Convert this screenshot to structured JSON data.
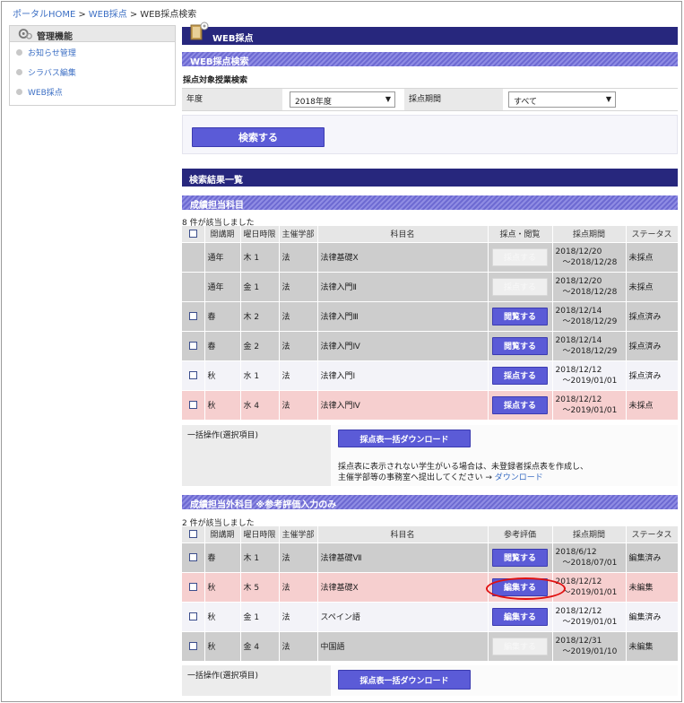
{
  "breadcrumb": {
    "home": "ポータルHOME",
    "sep": ">",
    "item1": "WEB採点",
    "current": "WEB採点検索"
  },
  "sidebar": {
    "title": "管理機能",
    "items": [
      {
        "label": "お知らせ管理"
      },
      {
        "label": "シラバス編集"
      },
      {
        "label": "WEB採点"
      }
    ]
  },
  "page": {
    "title": "WEB採点"
  },
  "search": {
    "section_title": "WEB採点検索",
    "subtitle": "採点対象授業検索",
    "year_label": "年度",
    "year_value": "2018年度",
    "period_label": "採点期間",
    "period_value": "すべて",
    "button": "検索する"
  },
  "results": {
    "title": "検索結果一覧"
  },
  "headers": {
    "open": "開講期",
    "day": "曜日時限",
    "faculty": "主催学部",
    "subject": "科目名",
    "grade_view": "採点・閲覧",
    "ref_eval": "参考評価",
    "period": "採点期間",
    "status": "ステータス"
  },
  "section1": {
    "title": "成績担当科目",
    "count": "8 件が該当しました",
    "rows": [
      {
        "open": "通年",
        "day": "木 1",
        "fac": "法",
        "subject": "法律基礎X",
        "btn": "採点する",
        "p1": "2018/12/20",
        "p2": "～2018/12/28",
        "status": "未採点"
      },
      {
        "open": "通年",
        "day": "金 1",
        "fac": "法",
        "subject": "法律入門Ⅱ",
        "btn": "採点する",
        "p1": "2018/12/20",
        "p2": "～2018/12/28",
        "status": "未採点"
      },
      {
        "open": "春",
        "day": "木 2",
        "fac": "法",
        "subject": "法律入門Ⅲ",
        "btn": "閲覧する",
        "p1": "2018/12/14",
        "p2": "～2018/12/29",
        "status": "採点済み"
      },
      {
        "open": "春",
        "day": "金 2",
        "fac": "法",
        "subject": "法律入門Ⅳ",
        "btn": "閲覧する",
        "p1": "2018/12/14",
        "p2": "～2018/12/29",
        "status": "採点済み"
      },
      {
        "open": "秋",
        "day": "水 1",
        "fac": "法",
        "subject": "法律入門Ⅰ",
        "btn": "採点する",
        "p1": "2018/12/12",
        "p2": "～2019/01/01",
        "status": "採点済み"
      },
      {
        "open": "秋",
        "day": "水 4",
        "fac": "法",
        "subject": "法律入門Ⅳ",
        "btn": "採点する",
        "p1": "2018/12/12",
        "p2": "～2019/01/01",
        "status": "未採点"
      }
    ],
    "bulk_label": "一括操作(選択項目)",
    "download_button": "採点表一括ダウンロード",
    "note_line1": "採点表に表示されない学生がいる場合は、未登録者採点表を作成し、",
    "note_line2": "主催学部等の事務室へ提出してください →",
    "note_link": "ダウンロード"
  },
  "section2": {
    "title": "成績担当外科目 ※参考評価入力のみ",
    "count": "2 件が該当しました",
    "rows": [
      {
        "open": "春",
        "day": "木 1",
        "fac": "法",
        "subject": "法律基礎Ⅶ",
        "btn": "閲覧する",
        "p1": "2018/6/12",
        "p2": "～2018/07/01",
        "status": "編集済み"
      },
      {
        "open": "秋",
        "day": "木 5",
        "fac": "法",
        "subject": "法律基礎X",
        "btn": "編集する",
        "p1": "2018/12/12",
        "p2": "～2019/01/01",
        "status": "未編集"
      },
      {
        "open": "秋",
        "day": "金 1",
        "fac": "法",
        "subject": "スペイン語",
        "btn": "編集する",
        "p1": "2018/12/12",
        "p2": "～2019/01/01",
        "status": "編集済み"
      },
      {
        "open": "秋",
        "day": "金 4",
        "fac": "法",
        "subject": "中国語",
        "btn": "編集する",
        "p1": "2018/12/31",
        "p2": "～2019/01/10",
        "status": "未編集"
      }
    ],
    "bulk_label": "一括操作(選択項目)",
    "download_button": "採点表一括ダウンロード"
  },
  "colors": {
    "navy": "#27277d",
    "accent_button": "#5b5bd7",
    "annotation": "#e01010",
    "pink_row": "#f6cfcf",
    "gray_row": "#cdcdcd"
  }
}
